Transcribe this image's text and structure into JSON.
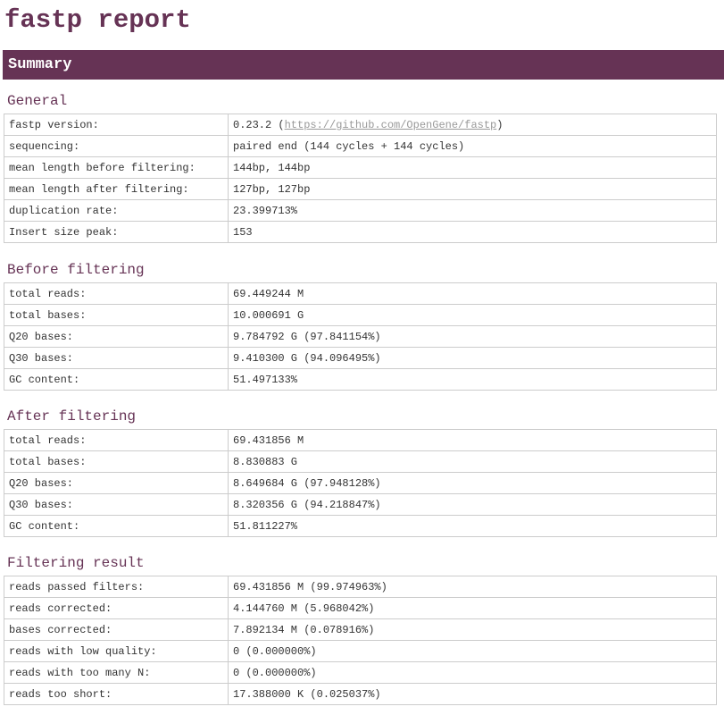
{
  "title": "fastp report",
  "summary_label": "Summary",
  "general": {
    "heading": "General",
    "rows": [
      {
        "key": "fastp version:",
        "value": "0.23.2 (",
        "link": "https://github.com/OpenGene/fastp",
        "suffix": ")"
      },
      {
        "key": "sequencing:",
        "value": "paired end (144 cycles + 144 cycles)"
      },
      {
        "key": "mean length before filtering:",
        "value": "144bp, 144bp"
      },
      {
        "key": "mean length after filtering:",
        "value": "127bp, 127bp"
      },
      {
        "key": "duplication rate:",
        "value": "23.399713%"
      },
      {
        "key": "Insert size peak:",
        "value": "153"
      }
    ]
  },
  "before_filtering": {
    "heading": "Before filtering",
    "rows": [
      {
        "key": "total reads:",
        "value": "69.449244 M"
      },
      {
        "key": "total bases:",
        "value": "10.000691 G"
      },
      {
        "key": "Q20 bases:",
        "value": "9.784792 G (97.841154%)"
      },
      {
        "key": "Q30 bases:",
        "value": "9.410300 G (94.096495%)"
      },
      {
        "key": "GC content:",
        "value": "51.497133%"
      }
    ]
  },
  "after_filtering": {
    "heading": "After filtering",
    "rows": [
      {
        "key": "total reads:",
        "value": "69.431856 M"
      },
      {
        "key": "total bases:",
        "value": "8.830883 G"
      },
      {
        "key": "Q20 bases:",
        "value": "8.649684 G (97.948128%)"
      },
      {
        "key": "Q30 bases:",
        "value": "8.320356 G (94.218847%)"
      },
      {
        "key": "GC content:",
        "value": "51.811227%"
      }
    ]
  },
  "filtering_result": {
    "heading": "Filtering result",
    "rows": [
      {
        "key": "reads passed filters:",
        "value": "69.431856 M (99.974963%)"
      },
      {
        "key": "reads corrected:",
        "value": "4.144760 M (5.968042%)"
      },
      {
        "key": "bases corrected:",
        "value": "7.892134 M (0.078916%)"
      },
      {
        "key": "reads with low quality:",
        "value": "0 (0.000000%)"
      },
      {
        "key": "reads with too many N:",
        "value": "0 (0.000000%)"
      },
      {
        "key": "reads too short:",
        "value": "17.388000 K (0.025037%)"
      }
    ]
  }
}
